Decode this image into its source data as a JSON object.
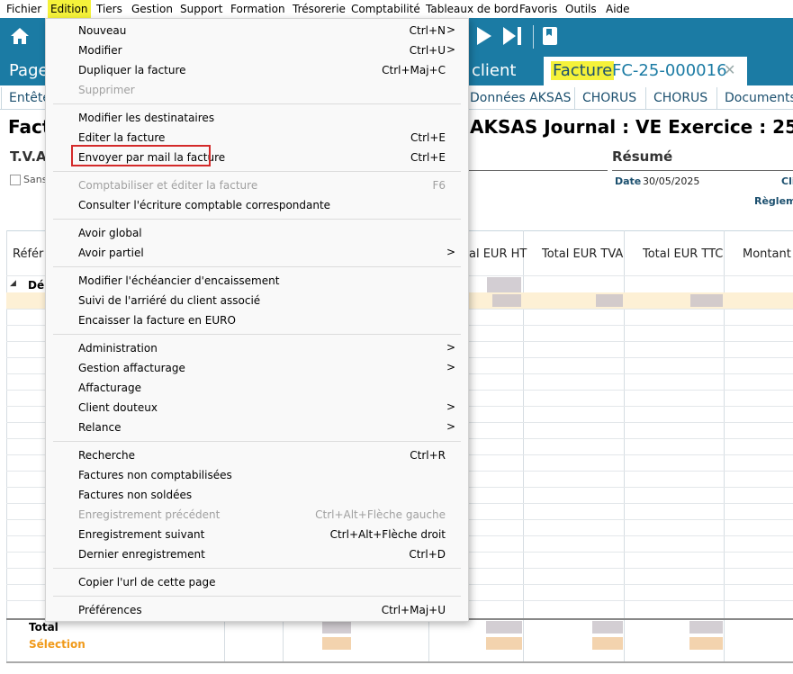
{
  "menubar": {
    "items": [
      "Fichier",
      "Edition",
      "Tiers",
      "Gestion",
      "Support",
      "Formation",
      "Trésorerie",
      "Comptabilité",
      "Tableaux de bord",
      "Favoris",
      "Outils",
      "Aide"
    ],
    "active": "Edition"
  },
  "tabs": {
    "page_label": "Page",
    "client_label": "client",
    "active_tab_label": "Facture",
    "active_tab_number": "FC-25-000016",
    "close_glyph": "✕"
  },
  "subtabs": [
    "Entête",
    "Données AKSAS",
    "CHORUS",
    "CHORUS",
    "Documents"
  ],
  "document": {
    "heading_left": "Fact",
    "heading_right": "AKSAS  Journal : VE  Exercice : 25",
    "tva_label": "T.V.A",
    "checkbox_label": "Sans",
    "resume_label": "Résumé",
    "date_label": "Date",
    "date_value": "30/05/2025",
    "client_label": "Cli",
    "reglement_label": "Règlem"
  },
  "grid": {
    "columns": [
      "Référ",
      "al EUR HT",
      "Total EUR TVA",
      "Total EUR TTC",
      "Montant r"
    ],
    "group_label": "Dé",
    "group_toggle": "◢",
    "total_label": "Total",
    "selection_label": "Sélection"
  },
  "dropdown": {
    "items": [
      {
        "label": "Nouveau",
        "shortcut": "Ctrl+N",
        "arrow": ">"
      },
      {
        "label": "Modifier",
        "shortcut": "Ctrl+U",
        "arrow": ">"
      },
      {
        "label": "Dupliquer la facture",
        "shortcut": "Ctrl+Maj+C"
      },
      {
        "label": "Supprimer",
        "disabled": true
      },
      {
        "label": "Modifier les destinataires"
      },
      {
        "label": "Editer la facture",
        "shortcut": "Ctrl+E"
      },
      {
        "label": "Envoyer par mail la facture",
        "shortcut": "Ctrl+E",
        "highlighted": true
      },
      {
        "label": "Comptabiliser et éditer la facture",
        "shortcut": "F6",
        "disabled": true
      },
      {
        "label": "Consulter l'écriture comptable correspondante"
      },
      {
        "label": "Avoir global"
      },
      {
        "label": "Avoir partiel",
        "arrow": ">"
      },
      {
        "label": "Modifier l'échéancier d'encaissement"
      },
      {
        "label": "Suivi de l'arriéré du client associé"
      },
      {
        "label": "Encaisser la facture en EURO"
      },
      {
        "label": "Administration",
        "arrow": ">"
      },
      {
        "label": "Gestion affacturage",
        "arrow": ">"
      },
      {
        "label": "Affacturage"
      },
      {
        "label": "Client douteux",
        "arrow": ">"
      },
      {
        "label": "Relance",
        "arrow": ">"
      },
      {
        "label": "Recherche",
        "shortcut": "Ctrl+R"
      },
      {
        "label": "Factures non comptabilisées"
      },
      {
        "label": "Factures non soldées"
      },
      {
        "label": "Enregistrement précédent",
        "shortcut": "Ctrl+Alt+Flèche gauche",
        "disabled": true
      },
      {
        "label": "Enregistrement suivant",
        "shortcut": "Ctrl+Alt+Flèche droit"
      },
      {
        "label": "Dernier enregistrement",
        "shortcut": "Ctrl+D"
      },
      {
        "label": "Copier l'url de cette page"
      },
      {
        "label": "Préférences",
        "shortcut": "Ctrl+Maj+U"
      }
    ]
  },
  "colors": {
    "accent": "#1b7ba4",
    "highlight": "#f5f23a",
    "danger": "#d42a2a"
  }
}
